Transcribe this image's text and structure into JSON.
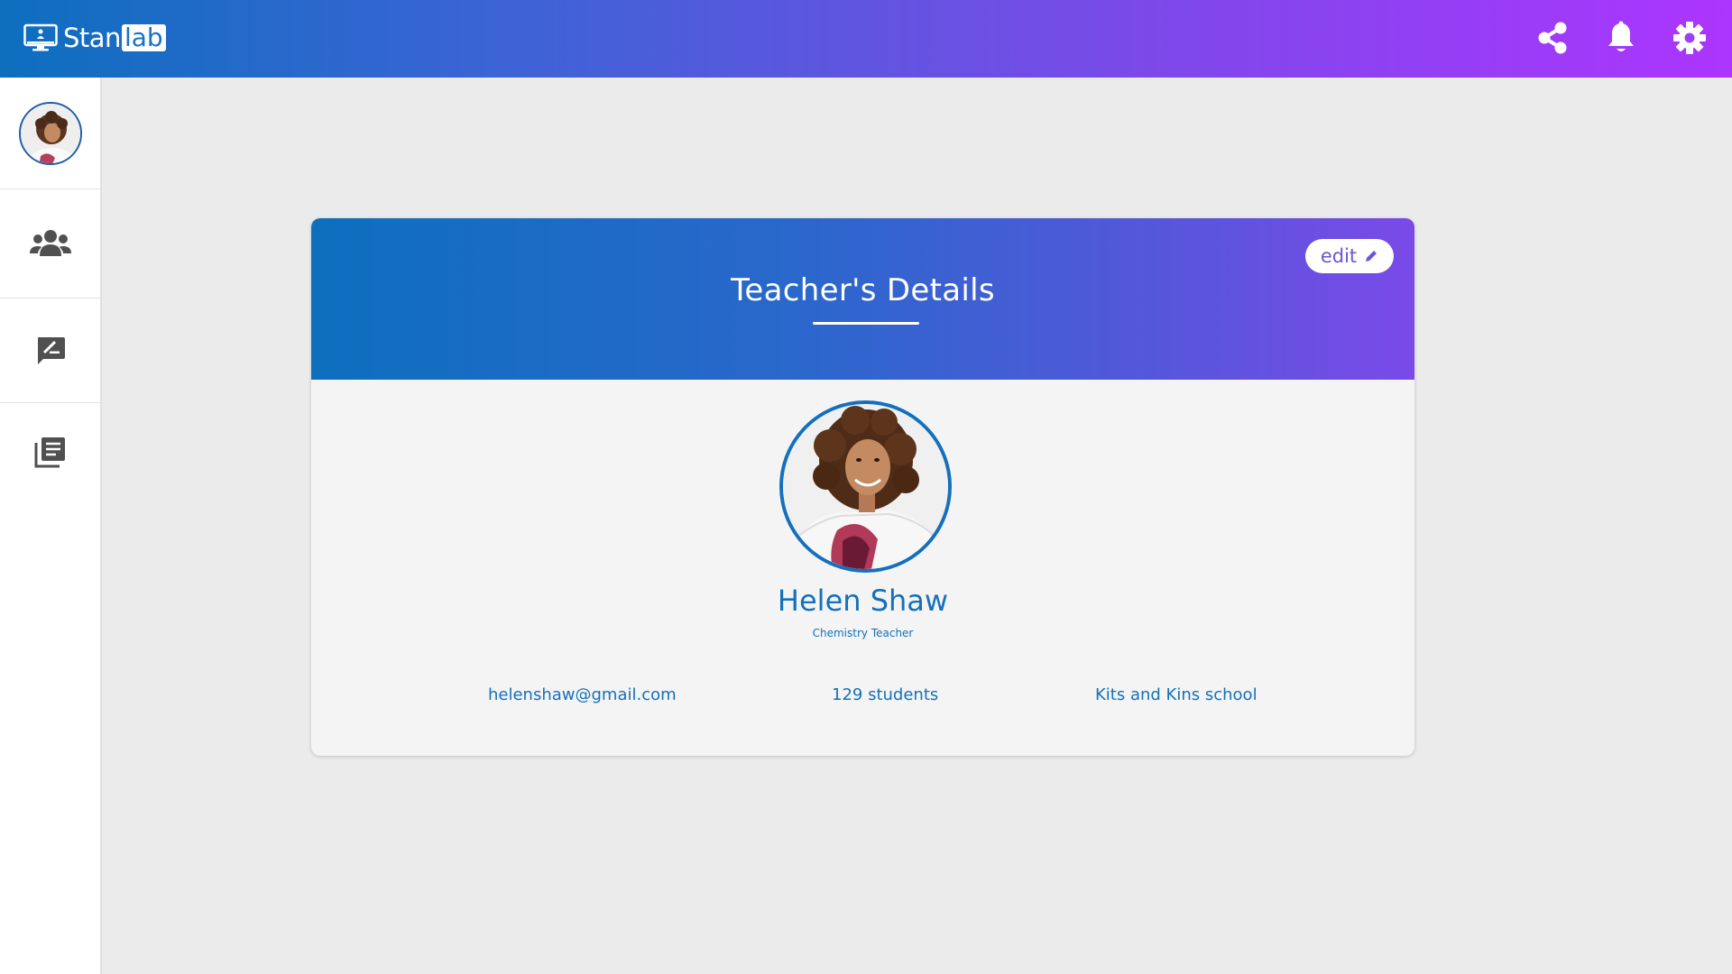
{
  "app": {
    "logo_prefix": "Stan",
    "logo_suffix": "lab",
    "brand_gradient": [
      "#0d6fbe",
      "#ac35ff"
    ]
  },
  "topbar": {
    "icons": [
      "share-icon",
      "bell-icon",
      "gear-icon"
    ]
  },
  "sidebar": {
    "items": [
      {
        "name": "profile-avatar",
        "icon": "avatar"
      },
      {
        "name": "students",
        "icon": "users-icon"
      },
      {
        "name": "feedback",
        "icon": "feedback-icon"
      },
      {
        "name": "library",
        "icon": "library-icon"
      }
    ]
  },
  "card": {
    "title": "Teacher's Details",
    "edit_label": "edit",
    "name": "Helen Shaw",
    "role": "Chemistry Teacher",
    "email": "helenshaw@gmail.com",
    "students": "129 students",
    "school": "Kits and Kins school",
    "accent": "#1470bc"
  }
}
